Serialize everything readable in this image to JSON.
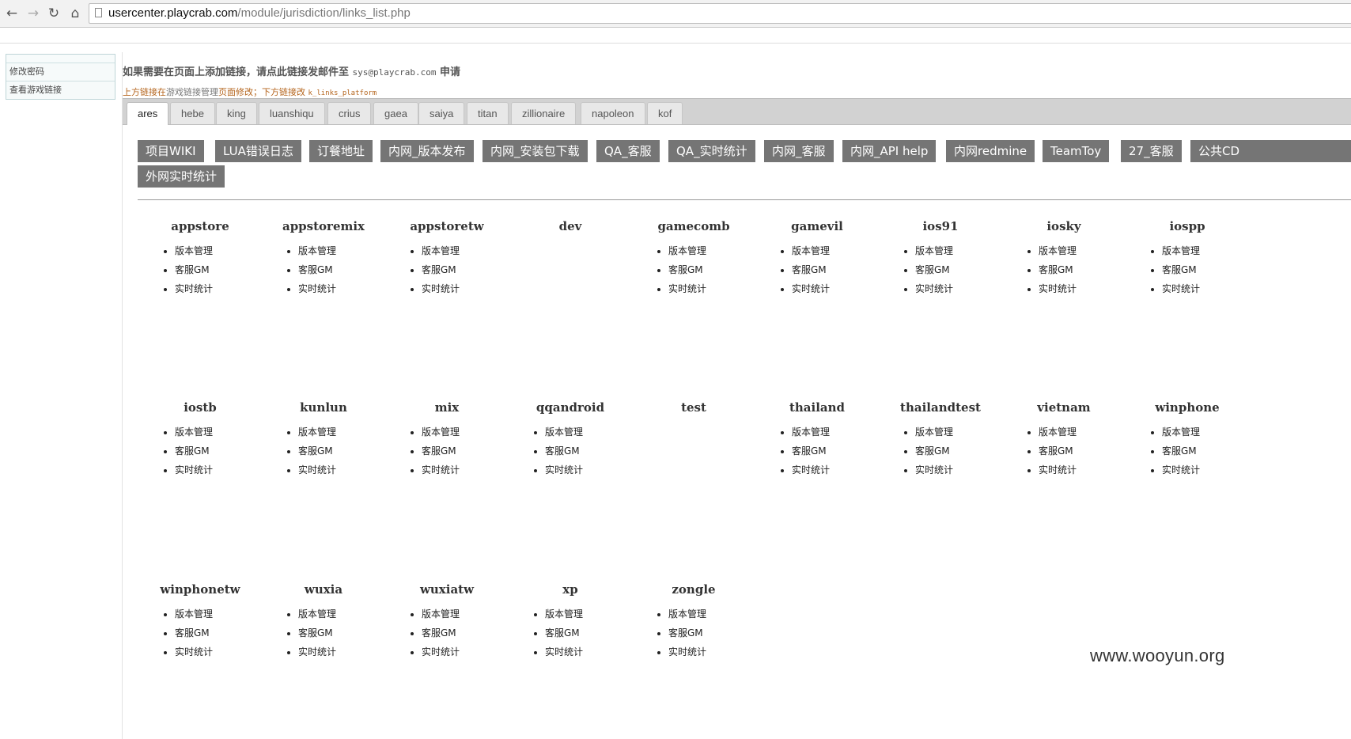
{
  "browser": {
    "url_host": "usercenter.playcrab.com",
    "url_path": "/module/jurisdiction/links_list.php"
  },
  "sidebar": {
    "items": [
      {
        "label": "修改密码"
      },
      {
        "label": "查看游戏链接"
      }
    ]
  },
  "notice": {
    "text_before": "如果需要在页面上添加链接，请点此链接发邮件至 ",
    "email": "sys@playcrab.com",
    "text_after": " 申请"
  },
  "sub_notice": {
    "part1": "上方链接在",
    "part2": "游戏链接管理",
    "part3": "页面修改；下方链接改 ",
    "code": "k_links_platform"
  },
  "tabs": [
    "ares",
    "hebe",
    "king",
    "luanshiqu",
    "crius",
    "gaea",
    "saiya",
    "titan",
    "zillionaire",
    "napoleon",
    "kof"
  ],
  "active_tab": "ares",
  "link_buttons": [
    "项目WIKI",
    "LUA错误日志",
    "订餐地址",
    "内网_版本发布",
    "内网_安装包下载",
    "QA_客服",
    "QA_实时统计",
    "内网_客服",
    "内网_API help",
    "内网redmine",
    "TeamToy",
    "27_客服",
    "公共CD",
    "外网实时统计"
  ],
  "platforms": [
    {
      "name": "appstore",
      "links": [
        "版本管理",
        "客服GM",
        "实时统计"
      ]
    },
    {
      "name": "appstoremix",
      "links": [
        "版本管理",
        "客服GM",
        "实时统计"
      ]
    },
    {
      "name": "appstoretw",
      "links": [
        "版本管理",
        "客服GM",
        "实时统计"
      ]
    },
    {
      "name": "dev",
      "links": []
    },
    {
      "name": "gamecomb",
      "links": [
        "版本管理",
        "客服GM",
        "实时统计"
      ]
    },
    {
      "name": "gamevil",
      "links": [
        "版本管理",
        "客服GM",
        "实时统计"
      ]
    },
    {
      "name": "ios91",
      "links": [
        "版本管理",
        "客服GM",
        "实时统计"
      ]
    },
    {
      "name": "iosky",
      "links": [
        "版本管理",
        "客服GM",
        "实时统计"
      ]
    },
    {
      "name": "iospp",
      "links": [
        "版本管理",
        "客服GM",
        "实时统计"
      ]
    },
    {
      "name": "iostb",
      "links": [
        "版本管理",
        "客服GM",
        "实时统计"
      ]
    },
    {
      "name": "kunlun",
      "links": [
        "版本管理",
        "客服GM",
        "实时统计"
      ]
    },
    {
      "name": "mix",
      "links": [
        "版本管理",
        "客服GM",
        "实时统计"
      ]
    },
    {
      "name": "qqandroid",
      "links": [
        "版本管理",
        "客服GM",
        "实时统计"
      ]
    },
    {
      "name": "test",
      "links": []
    },
    {
      "name": "thailand",
      "links": [
        "版本管理",
        "客服GM",
        "实时统计"
      ]
    },
    {
      "name": "thailandtest",
      "links": [
        "版本管理",
        "客服GM",
        "实时统计"
      ]
    },
    {
      "name": "vietnam",
      "links": [
        "版本管理",
        "客服GM",
        "实时统计"
      ]
    },
    {
      "name": "winphone",
      "links": [
        "版本管理",
        "客服GM",
        "实时统计"
      ]
    },
    {
      "name": "winphonetw",
      "links": [
        "版本管理",
        "客服GM",
        "实时统计"
      ]
    },
    {
      "name": "wuxia",
      "links": [
        "版本管理",
        "客服GM",
        "实时统计"
      ]
    },
    {
      "name": "wuxiatw",
      "links": [
        "版本管理",
        "客服GM",
        "实时统计"
      ]
    },
    {
      "name": "xp",
      "links": [
        "版本管理",
        "客服GM",
        "实时统计"
      ]
    },
    {
      "name": "zongle",
      "links": [
        "版本管理",
        "客服GM",
        "实时统计"
      ]
    }
  ],
  "watermark": "www.wooyun.org"
}
